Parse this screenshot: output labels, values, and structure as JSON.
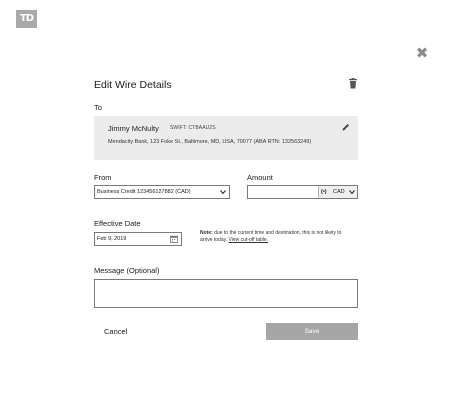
{
  "brand": {
    "logo_text": "TD"
  },
  "dialog": {
    "title": "Edit Wire Details",
    "close_icon": "close-icon",
    "delete_icon": "trash-icon"
  },
  "to": {
    "label": "To",
    "name": "Jimmy McNulty",
    "swift": "SWIFT: CTBAAU2S",
    "address": "Mendacity Bank, 123 Foke St., Baltimore, MD, USA, 70077 (ABA RTN: 132563249)",
    "edit_icon": "pencil-icon"
  },
  "from": {
    "label": "From",
    "selected": "Business Credit 123456127882 (CAD)"
  },
  "amount": {
    "label": "Amount",
    "value": "",
    "currency_flag": "(•)",
    "currency_code": "CAD"
  },
  "effective_date": {
    "label": "Effective Date",
    "value": "Feb 9, 2019",
    "note_bold": "Note:",
    "note_text": " due to the current time and destination, this is not likely to arrive today. ",
    "note_link": "View cut-off table."
  },
  "message": {
    "label": "Message (Optional)",
    "value": ""
  },
  "actions": {
    "cancel": "Cancel",
    "save": "Save"
  },
  "colors": {
    "save_button": "#a6a6a6",
    "logo_bg": "#a9a9a9",
    "recipient_bg": "#ececec"
  }
}
